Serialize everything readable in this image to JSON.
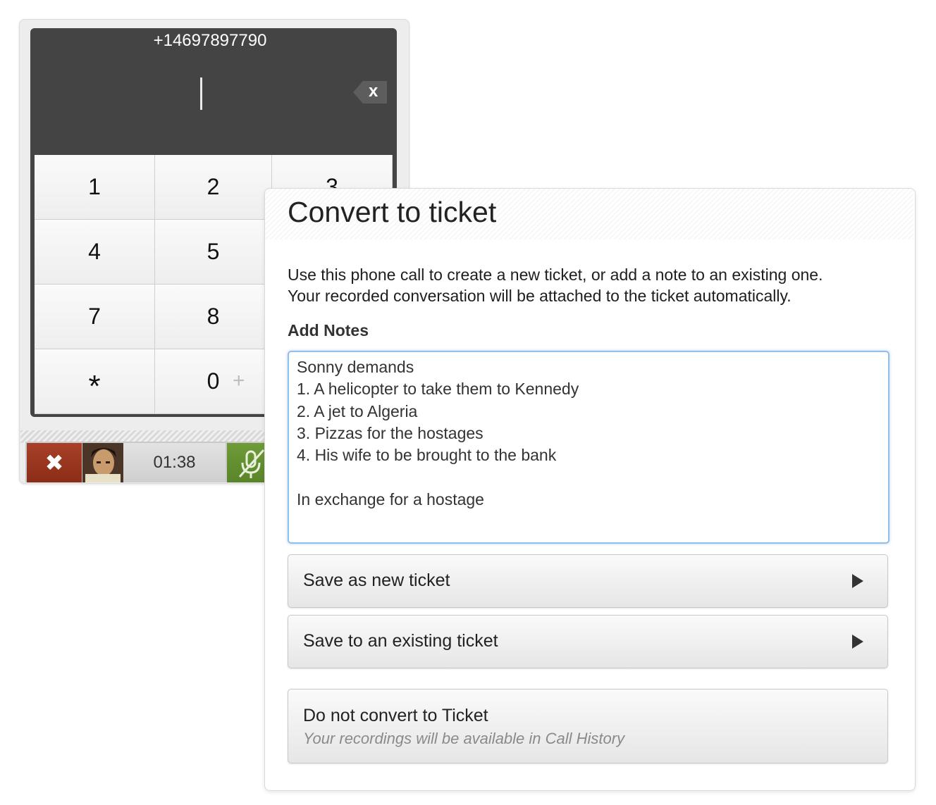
{
  "dialer": {
    "number": "+14697897790",
    "backspace_label": "x",
    "keys": [
      "1",
      "2",
      "3",
      "4",
      "5",
      "",
      "7",
      "8",
      "",
      "*",
      "0",
      ""
    ],
    "zero_sub": "+",
    "timer": "01:38",
    "hangup_label": "✖"
  },
  "panel": {
    "title": "Convert to ticket",
    "description_line1": "Use this phone call to create a new ticket, or add a note to an existing one.",
    "description_line2": "Your recorded conversation will be attached to the ticket automatically.",
    "notes_label": "Add Notes",
    "notes_value": "Sonny demands\n1. A helicopter to take them to Kennedy\n2. A jet to Algeria\n3. Pizzas for the hostages\n4. His wife to be brought to the bank\n\nIn exchange for a hostage",
    "save_new_label": "Save as new ticket",
    "save_existing_label": "Save to an existing ticket",
    "no_convert_label": "Do not convert to Ticket",
    "no_convert_hint": "Your recordings will be available in Call History"
  },
  "colors": {
    "screen": "#444444",
    "hangup": "#9b3620",
    "mute": "#679133",
    "focus_border": "#8fc0ec"
  },
  "icons": {
    "backspace": "backspace-icon",
    "hangup": "close-icon",
    "mute": "microphone-muted-icon",
    "arrow": "play-arrow-icon"
  }
}
